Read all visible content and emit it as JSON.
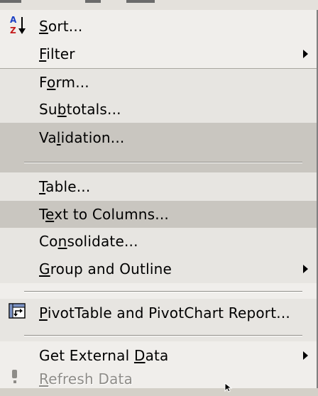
{
  "menu": {
    "sort": "Sort...",
    "filter": "Filter",
    "form": "Form...",
    "subtotals": "Subtotals...",
    "validation": "Validation...",
    "table": "Table...",
    "text_to_columns": "Text to Columns...",
    "consolidate": "Consolidate...",
    "group_outline": "Group and Outline",
    "pivot": "PivotTable and PivotChart Report...",
    "external": "Get External Data",
    "refresh": "Refresh Data"
  },
  "icons": {
    "sort": "sort-ascending-az-icon",
    "pivot": "pivottable-icon",
    "refresh": "refresh-data-icon",
    "submenu": "submenu-arrow-icon"
  },
  "colors": {
    "menu_bg": "#f0eeeb",
    "highlight_light": "#e7e5e1",
    "highlight_dark": "#c9c6c0",
    "disabled_text": "#8e8c88"
  }
}
